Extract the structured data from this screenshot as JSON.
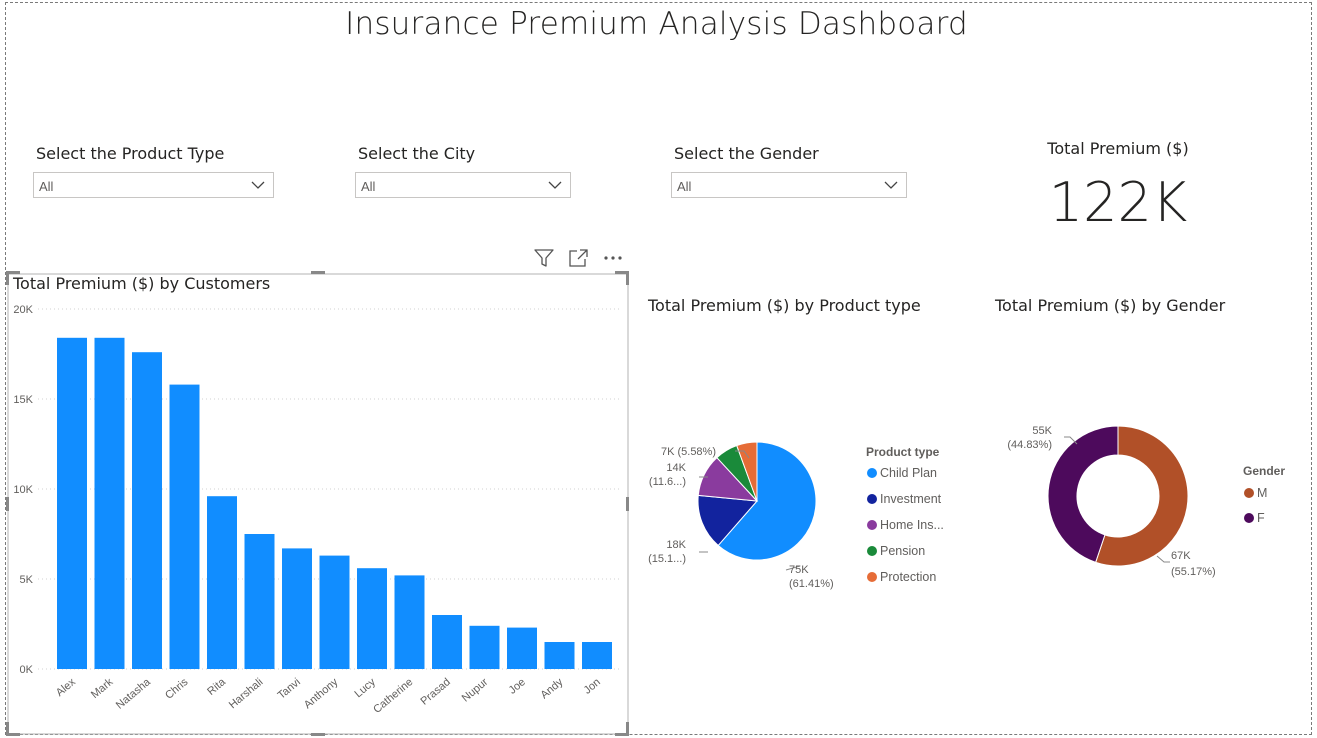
{
  "dashboard": {
    "title": "Insurance Premium Analysis Dashboard",
    "accent_color": "#118dff"
  },
  "slicers": [
    {
      "label": "Select the Product Type",
      "value": "All"
    },
    {
      "label": "Select the City",
      "value": "All"
    },
    {
      "label": "Select the Gender",
      "value": "All"
    }
  ],
  "card": {
    "label": "Total Premium ($)",
    "value": "122K"
  },
  "visual_toolbar": {
    "icons": [
      "filter-icon",
      "focus-mode-icon",
      "more-options-icon"
    ]
  },
  "chart_data": [
    {
      "type": "bar",
      "title": "Total Premium ($) by Customers",
      "categories": [
        "Alex",
        "Mark",
        "Natasha",
        "Chris",
        "Rita",
        "Harshali",
        "Tanvi",
        "Anthony",
        "Lucy",
        "Catherine",
        "Prasad",
        "Nupur",
        "Joe",
        "Andy",
        "Jon"
      ],
      "values": [
        18400,
        18400,
        17600,
        15800,
        9600,
        7500,
        6700,
        6300,
        5600,
        5200,
        3000,
        2400,
        2300,
        1500,
        1500
      ],
      "y_ticks": [
        "0K",
        "5K",
        "10K",
        "15K",
        "20K"
      ],
      "ylim": [
        0,
        20000
      ],
      "grid": true,
      "color": "#118dff"
    },
    {
      "type": "pie",
      "title": "Total Premium ($) by Product type",
      "legend_title": "Product type",
      "legend_position": "right",
      "slices": [
        {
          "name": "Child Plan",
          "value": 75,
          "percent": 61.41,
          "color": "#118dff",
          "label_line1": "75K",
          "label_line2": "(61.41%)"
        },
        {
          "name": "Investment",
          "value": 18,
          "percent": 15.1,
          "color": "#12239e",
          "label_line1": "18K",
          "label_line2": "(15.1...)"
        },
        {
          "name": "Home Ins...",
          "value": 14,
          "percent": 11.6,
          "color": "#8a3b9e",
          "label_line1": "14K",
          "label_line2": "(11.6...)"
        },
        {
          "name": "Pension",
          "value": 7,
          "percent": 6.3,
          "color": "#1a8a3a",
          "label_line1": "",
          "label_line2": ""
        },
        {
          "name": "Protection",
          "value": 7,
          "percent": 5.58,
          "color": "#e66c37",
          "label_line1": "7K (5.58%)",
          "label_line2": ""
        }
      ]
    },
    {
      "type": "donut",
      "title": "Total Premium ($) by Gender",
      "legend_title": "Gender",
      "legend_position": "right",
      "slices": [
        {
          "name": "M",
          "value": 67,
          "percent": 55.17,
          "color": "#b15028",
          "label_line1": "67K",
          "label_line2": "(55.17%)"
        },
        {
          "name": "F",
          "value": 55,
          "percent": 44.83,
          "color": "#4d0a5c",
          "label_line1": "55K",
          "label_line2": "(44.83%)"
        }
      ]
    }
  ]
}
